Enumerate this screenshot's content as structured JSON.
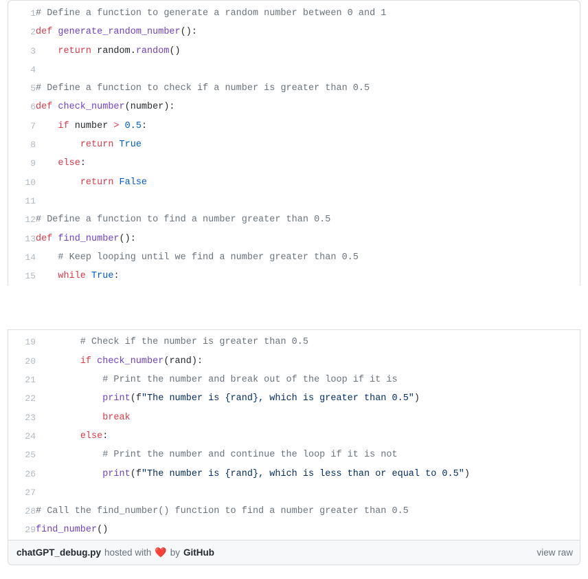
{
  "gist": {
    "filename": "chatGPT_debug.py",
    "hosted_with_label": "hosted with",
    "by_label": "by",
    "host_name": "GitHub",
    "heart_icon": "heart-icon",
    "heart_glyph": "❤️",
    "view_raw_label": "view raw",
    "accent_colors": {
      "keyword": "#d73a49",
      "function": "#6f42c1",
      "constant": "#005cc5",
      "string": "#032f62",
      "comment": "#6a737d",
      "plain": "#24292e",
      "line_number": "#afb8c1",
      "border": "#dddddd",
      "footer_bg": "#f6f8fa"
    }
  },
  "blocks": [
    {
      "id": "code-block-1",
      "lines": [
        {
          "n": "1",
          "tokens": [
            {
              "t": "# Define a function to generate a random number between 0 and 1",
              "c": "com"
            }
          ]
        },
        {
          "n": "2",
          "tokens": [
            {
              "t": "def ",
              "c": "kw"
            },
            {
              "t": "generate_random_number",
              "c": "fn"
            },
            {
              "t": "():",
              "c": "pln"
            }
          ]
        },
        {
          "n": "3",
          "tokens": [
            {
              "t": "    ",
              "c": "pln"
            },
            {
              "t": "return",
              "c": "kw"
            },
            {
              "t": " random.",
              "c": "pln"
            },
            {
              "t": "random",
              "c": "fn"
            },
            {
              "t": "()",
              "c": "pln"
            }
          ]
        },
        {
          "n": "4",
          "tokens": [
            {
              "t": "",
              "c": "pln"
            }
          ]
        },
        {
          "n": "5",
          "tokens": [
            {
              "t": "# Define a function to check if a number is greater than 0.5",
              "c": "com"
            }
          ]
        },
        {
          "n": "6",
          "tokens": [
            {
              "t": "def ",
              "c": "kw"
            },
            {
              "t": "check_number",
              "c": "fn"
            },
            {
              "t": "(number):",
              "c": "pln"
            }
          ]
        },
        {
          "n": "7",
          "tokens": [
            {
              "t": "    ",
              "c": "pln"
            },
            {
              "t": "if",
              "c": "kw"
            },
            {
              "t": " number ",
              "c": "pln"
            },
            {
              "t": ">",
              "c": "kw"
            },
            {
              "t": " ",
              "c": "pln"
            },
            {
              "t": "0.5",
              "c": "num"
            },
            {
              "t": ":",
              "c": "pln"
            }
          ]
        },
        {
          "n": "8",
          "tokens": [
            {
              "t": "        ",
              "c": "pln"
            },
            {
              "t": "return",
              "c": "kw"
            },
            {
              "t": " ",
              "c": "pln"
            },
            {
              "t": "True",
              "c": "con"
            }
          ]
        },
        {
          "n": "9",
          "tokens": [
            {
              "t": "    ",
              "c": "pln"
            },
            {
              "t": "else",
              "c": "kw"
            },
            {
              "t": ":",
              "c": "pln"
            }
          ]
        },
        {
          "n": "10",
          "tokens": [
            {
              "t": "        ",
              "c": "pln"
            },
            {
              "t": "return",
              "c": "kw"
            },
            {
              "t": " ",
              "c": "pln"
            },
            {
              "t": "False",
              "c": "con"
            }
          ]
        },
        {
          "n": "11",
          "tokens": [
            {
              "t": "",
              "c": "pln"
            }
          ]
        },
        {
          "n": "12",
          "tokens": [
            {
              "t": "# Define a function to find a number greater than 0.5",
              "c": "com"
            }
          ]
        },
        {
          "n": "13",
          "tokens": [
            {
              "t": "def ",
              "c": "kw"
            },
            {
              "t": "find_number",
              "c": "fn"
            },
            {
              "t": "():",
              "c": "pln"
            }
          ]
        },
        {
          "n": "14",
          "tokens": [
            {
              "t": "    # Keep looping until we find a number greater than 0.5",
              "c": "com"
            }
          ]
        },
        {
          "n": "15",
          "tokens": [
            {
              "t": "    ",
              "c": "pln"
            },
            {
              "t": "while",
              "c": "kw"
            },
            {
              "t": " ",
              "c": "pln"
            },
            {
              "t": "True",
              "c": "con"
            },
            {
              "t": ":",
              "c": "pln"
            }
          ]
        }
      ]
    },
    {
      "id": "code-block-2",
      "lines": [
        {
          "n": "19",
          "tokens": [
            {
              "t": "        # Check if the number is greater than 0.5",
              "c": "com"
            }
          ]
        },
        {
          "n": "20",
          "tokens": [
            {
              "t": "        ",
              "c": "pln"
            },
            {
              "t": "if",
              "c": "kw"
            },
            {
              "t": " ",
              "c": "pln"
            },
            {
              "t": "check_number",
              "c": "fn"
            },
            {
              "t": "(rand):",
              "c": "pln"
            }
          ]
        },
        {
          "n": "21",
          "tokens": [
            {
              "t": "            # Print the number and break out of the loop if it is",
              "c": "com"
            }
          ]
        },
        {
          "n": "22",
          "tokens": [
            {
              "t": "            ",
              "c": "pln"
            },
            {
              "t": "print",
              "c": "fn"
            },
            {
              "t": "(f",
              "c": "pln"
            },
            {
              "t": "\"The number is {rand}, which is greater than 0.5\"",
              "c": "str"
            },
            {
              "t": ")",
              "c": "pln"
            }
          ]
        },
        {
          "n": "23",
          "tokens": [
            {
              "t": "            ",
              "c": "pln"
            },
            {
              "t": "break",
              "c": "kw"
            }
          ]
        },
        {
          "n": "24",
          "tokens": [
            {
              "t": "        ",
              "c": "pln"
            },
            {
              "t": "else",
              "c": "kw"
            },
            {
              "t": ":",
              "c": "pln"
            }
          ]
        },
        {
          "n": "25",
          "tokens": [
            {
              "t": "            # Print the number and continue the loop if it is not",
              "c": "com"
            }
          ]
        },
        {
          "n": "26",
          "tokens": [
            {
              "t": "            ",
              "c": "pln"
            },
            {
              "t": "print",
              "c": "fn"
            },
            {
              "t": "(f",
              "c": "pln"
            },
            {
              "t": "\"The number is {rand}, which is less than or equal to 0.5\"",
              "c": "str"
            },
            {
              "t": ")",
              "c": "pln"
            }
          ]
        },
        {
          "n": "27",
          "tokens": [
            {
              "t": "",
              "c": "pln"
            }
          ]
        },
        {
          "n": "28",
          "tokens": [
            {
              "t": "# Call the find_number() function to find a number greater than 0.5",
              "c": "com"
            }
          ]
        },
        {
          "n": "29",
          "tokens": [
            {
              "t": "find_number",
              "c": "fn"
            },
            {
              "t": "()",
              "c": "pln"
            }
          ]
        }
      ]
    }
  ]
}
